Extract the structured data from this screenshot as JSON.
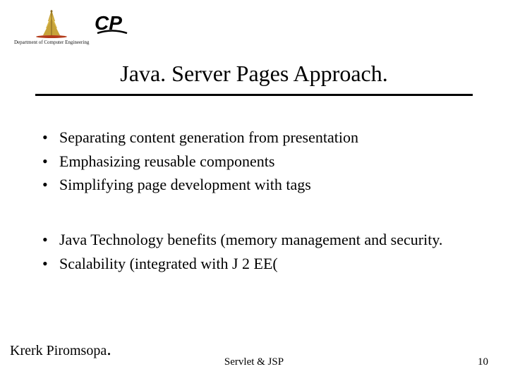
{
  "header": {
    "dept_label": "Department of Computer Engineering"
  },
  "title": "Java. Server Pages Approach.",
  "bullets_a": [
    "Separating content generation from presentation",
    "Emphasizing reusable components",
    "Simplifying page development with tags"
  ],
  "bullets_b": [
    "Java Technology benefits (memory management and security.",
    "Scalability (integrated with J 2 EE("
  ],
  "footer": {
    "author": "Krerk Piromsopa",
    "topic": "Servlet & JSP",
    "page": "10"
  }
}
